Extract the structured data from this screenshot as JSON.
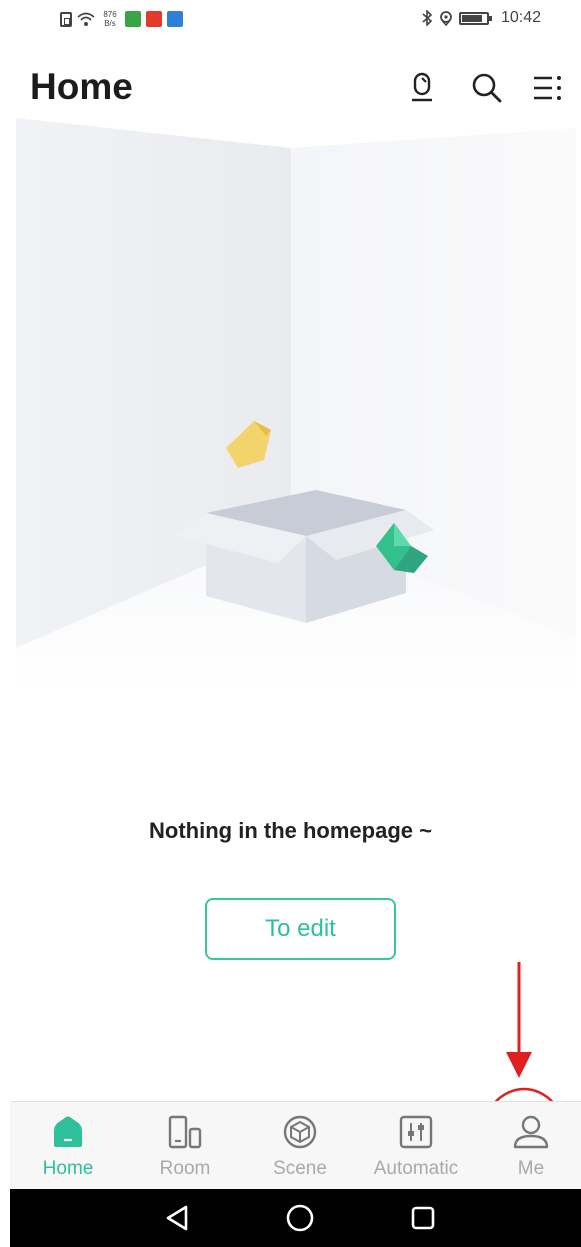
{
  "status_bar": {
    "speed_top": "876",
    "speed_bottom": "B/s",
    "time": "10:42"
  },
  "header": {
    "title": "Home"
  },
  "main": {
    "empty_message": "Nothing in the homepage ~",
    "edit_label": "To edit"
  },
  "tabs": [
    {
      "label": "Home",
      "icon": "home-icon",
      "active": true
    },
    {
      "label": "Room",
      "icon": "room-icon",
      "active": false
    },
    {
      "label": "Scene",
      "icon": "scene-icon",
      "active": false
    },
    {
      "label": "Automatic",
      "icon": "automatic-icon",
      "active": false
    },
    {
      "label": "Me",
      "icon": "user-icon",
      "active": false
    }
  ],
  "colors": {
    "accent": "#2dc09a",
    "annotation": "#e02020",
    "inactive": "#a9a9a9"
  }
}
